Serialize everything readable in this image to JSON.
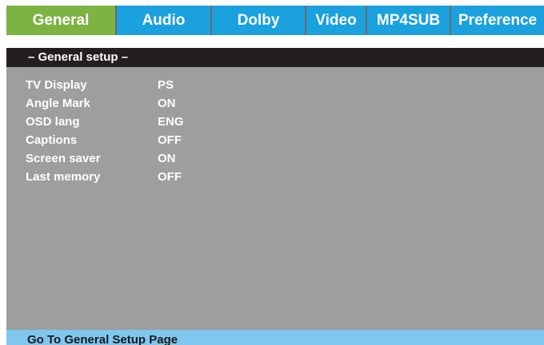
{
  "tabs": [
    {
      "label": "General"
    },
    {
      "label": "Audio"
    },
    {
      "label": "Dolby"
    },
    {
      "label": "Video"
    },
    {
      "label": "MP4SUB"
    },
    {
      "label": "Preference"
    }
  ],
  "active_tab": "General",
  "panel": {
    "header": "– General setup –",
    "items": [
      {
        "label": "TV Display",
        "value": "PS"
      },
      {
        "label": "Angle Mark",
        "value": "ON"
      },
      {
        "label": "OSD lang",
        "value": "ENG"
      },
      {
        "label": "Captions",
        "value": "OFF"
      },
      {
        "label": "Screen saver",
        "value": "ON"
      },
      {
        "label": "Last memory",
        "value": "OFF"
      }
    ]
  },
  "status": {
    "text": "Go To General Setup Page"
  },
  "colors": {
    "tab_blue": "#1aa1de",
    "tab_active_green": "#7cb342",
    "panel_gray": "#9e9e9e",
    "header_black": "#231f20",
    "status_light_blue": "#7fc7ee"
  }
}
